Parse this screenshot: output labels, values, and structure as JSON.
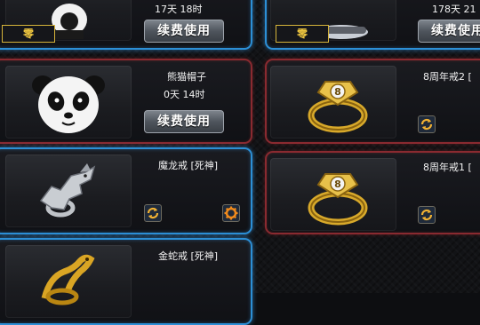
{
  "inventory": {
    "items": [
      {
        "id": "top-left",
        "name": "",
        "time_partial": "17天 18时",
        "button_label": "续费使用",
        "badge_label": "零",
        "frame_color": "#2c8fd6"
      },
      {
        "id": "top-right",
        "name": "",
        "time_partial": "178天 21",
        "button_label": "续费使用",
        "badge_label": "零",
        "frame_color": "#2c8fd6"
      },
      {
        "id": "panda-hat",
        "name": "熊猫帽子",
        "time": "0天 14时",
        "button_label": "续费使用",
        "icon": "panda-hat-icon",
        "frame_color": "#8a2a30"
      },
      {
        "id": "anniv-ring-2",
        "name": "8周年戒2 [",
        "icon": "gold-ring-icon",
        "action_icon": "refresh-icon",
        "frame_color": "#8a2a30"
      },
      {
        "id": "dragon-ring",
        "name": "魔龙戒 [死神]",
        "icon": "dragon-ring-icon",
        "action_icon": "refresh-icon",
        "extra_icon": "gear-icon",
        "frame_color": "#2c8fd6"
      },
      {
        "id": "anniv-ring-1",
        "name": "8周年戒1 [",
        "icon": "gold-ring-icon",
        "action_icon": "refresh-icon",
        "frame_color": "#8a2a30"
      },
      {
        "id": "golden-snake-ring",
        "name": "金蛇戒 [死神]",
        "icon": "snake-ring-icon",
        "frame_color": "#2c8fd6"
      }
    ]
  }
}
